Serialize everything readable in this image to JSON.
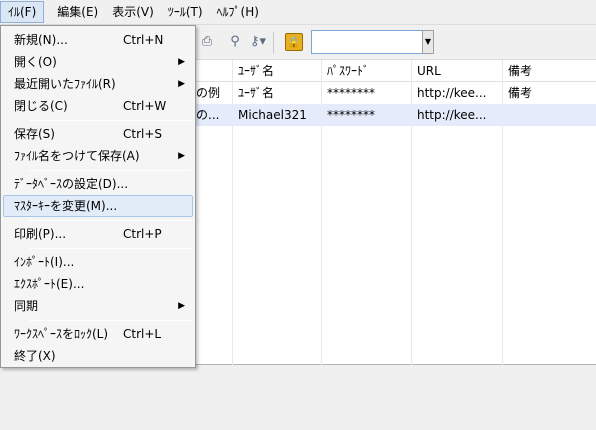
{
  "menubar": {
    "items": [
      "ｲﾙ(F)",
      "編集(E)",
      "表示(V)",
      "ﾂｰﾙ(T)",
      "ﾍﾙﾌﾟ(H)"
    ]
  },
  "toolbar": {
    "icons": [
      "print-icon",
      "search-icon",
      "key-icon",
      "lock-icon"
    ],
    "search_value": ""
  },
  "list": {
    "columns": [
      "ﾕｰｻﾞ名",
      "ﾊﾟｽﾜｰﾄﾞ",
      "URL",
      "備考"
    ],
    "rows": [
      {
        "title": "の例",
        "user": "ﾕｰｻﾞ名",
        "password": "********",
        "url": "http://kee...",
        "notes": "備考"
      },
      {
        "title": "の...",
        "user": "Michael321",
        "password": "********",
        "url": "http://kee...",
        "notes": ""
      }
    ]
  },
  "file_menu": {
    "items": [
      {
        "label": "新規(N)...",
        "shortcut": "Ctrl+N",
        "submenu": false
      },
      {
        "label": "開く(O)",
        "shortcut": "",
        "submenu": true
      },
      {
        "label": "最近開いたﾌｧｲﾙ(R)",
        "shortcut": "",
        "submenu": true
      },
      {
        "label": "閉じる(C)",
        "shortcut": "Ctrl+W",
        "submenu": false
      },
      {
        "label": "保存(S)",
        "shortcut": "Ctrl+S",
        "submenu": false
      },
      {
        "label": "ﾌｧｲﾙ名をつけて保存(A)",
        "shortcut": "",
        "submenu": true
      },
      {
        "label": "ﾃﾞｰﾀﾍﾞｰｽの設定(D)...",
        "shortcut": "",
        "submenu": false
      },
      {
        "label": "ﾏｽﾀｰｷｰを変更(M)...",
        "shortcut": "",
        "submenu": false,
        "highlighted": true
      },
      {
        "label": "印刷(P)...",
        "shortcut": "Ctrl+P",
        "submenu": false
      },
      {
        "label": "ｲﾝﾎﾟｰﾄ(I)...",
        "shortcut": "",
        "submenu": false
      },
      {
        "label": "ｴｸｽﾎﾟｰﾄ(E)...",
        "shortcut": "",
        "submenu": false
      },
      {
        "label": "同期",
        "shortcut": "",
        "submenu": true
      },
      {
        "label": "ﾜｰｸｽﾍﾟｰｽをﾛｯｸ(L)",
        "shortcut": "Ctrl+L",
        "submenu": false
      },
      {
        "label": "終了(X)",
        "shortcut": "",
        "submenu": false
      }
    ],
    "arrow_glyph": "▶"
  }
}
